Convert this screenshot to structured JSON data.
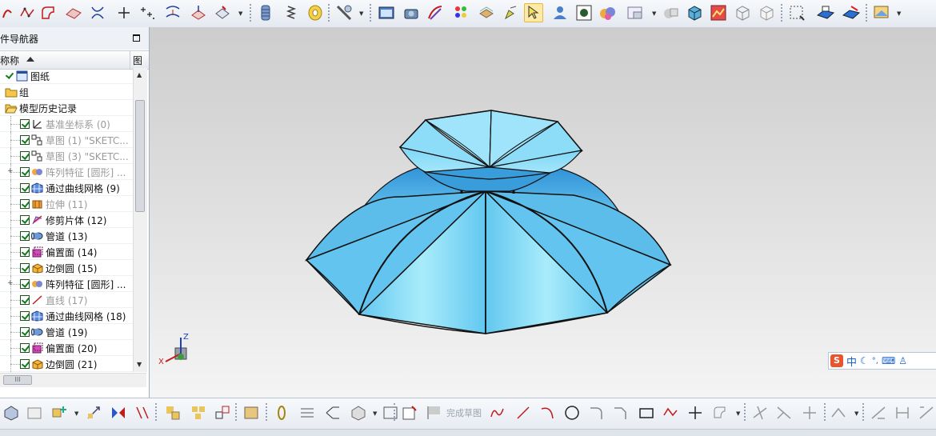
{
  "navigator": {
    "title": "件导航器",
    "col_name": "称称",
    "col_figure": "图",
    "hscroll_label": "III",
    "rows": [
      {
        "label": "图纸",
        "icon": "drawing-sheet-icon",
        "dim": false,
        "check": true
      },
      {
        "label": "组",
        "icon": "folder-icon",
        "dim": false,
        "check": false
      },
      {
        "label": "模型历史记录",
        "icon": "folder-open-icon",
        "dim": false,
        "check": false
      },
      {
        "label": "基准坐标系 (0)",
        "icon": "datum-csys-icon",
        "dim": true,
        "check": true
      },
      {
        "label": "草图 (1) \"SKETC...",
        "icon": "sketch-icon",
        "dim": true,
        "check": true
      },
      {
        "label": "草图 (3) \"SKETC...",
        "icon": "sketch-icon",
        "dim": true,
        "check": true
      },
      {
        "label": "阵列特征 [圆形] ...",
        "icon": "pattern-feature-icon",
        "dim": true,
        "check": true
      },
      {
        "label": "通过曲线网格 (9)",
        "icon": "curve-mesh-icon",
        "dim": false,
        "check": true
      },
      {
        "label": "拉伸 (11)",
        "icon": "extrude-icon",
        "dim": true,
        "check": true
      },
      {
        "label": "修剪片体 (12)",
        "icon": "trim-sheet-icon",
        "dim": false,
        "check": true
      },
      {
        "label": "管道 (13)",
        "icon": "tube-icon",
        "dim": false,
        "check": true
      },
      {
        "label": "偏置面 (14)",
        "icon": "offset-face-icon",
        "dim": false,
        "check": true
      },
      {
        "label": "边倒圆 (15)",
        "icon": "edge-blend-icon",
        "dim": false,
        "check": true
      },
      {
        "label": "阵列特征 [圆形] ...",
        "icon": "pattern-feature-icon",
        "dim": false,
        "check": true
      },
      {
        "label": "直线 (17)",
        "icon": "line-icon",
        "dim": true,
        "check": true
      },
      {
        "label": "通过曲线网格 (18)",
        "icon": "curve-mesh-icon",
        "dim": false,
        "check": true
      },
      {
        "label": "管道 (19)",
        "icon": "tube-icon",
        "dim": false,
        "check": true
      },
      {
        "label": "偏置面 (20)",
        "icon": "offset-face-icon",
        "dim": false,
        "check": true
      },
      {
        "label": "边倒圆 (21)",
        "icon": "edge-blend-icon",
        "dim": false,
        "check": true
      }
    ]
  },
  "triad": {
    "z": "Z",
    "x": "X"
  },
  "ime": {
    "logo": "S",
    "lang": "中"
  },
  "bottom": {
    "finish_sketch": "完成草图"
  },
  "colors": {
    "surface_light": "#a9ecfb",
    "surface_mid": "#62c7ef",
    "surface_dark": "#2f8fd6",
    "check_green": "#0c7a17"
  }
}
